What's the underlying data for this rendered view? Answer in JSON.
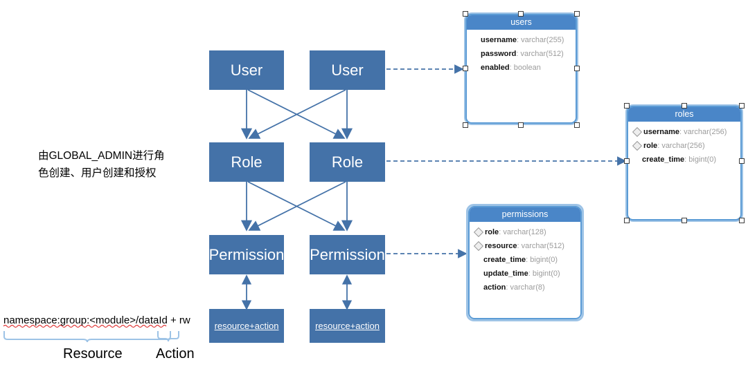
{
  "diagram": {
    "title": "RBAC permission model diagram",
    "colors": {
      "box_fill": "#4472A8",
      "table_header": "#4A86C8",
      "table_border": "#5B9BD5",
      "connector": "#4472A8",
      "arrow": "#4472A8",
      "selection_handle_border": "#3C3C3C",
      "spellcheck_underline": "#E03A3A",
      "brace": "#9DC3E6"
    },
    "flow_boxes": [
      {
        "id": "user-left",
        "label": "User"
      },
      {
        "id": "user-right",
        "label": "User"
      },
      {
        "id": "role-left",
        "label": "Role"
      },
      {
        "id": "role-right",
        "label": "Role"
      },
      {
        "id": "permission-left",
        "label": "Permission"
      },
      {
        "id": "permission-right",
        "label": "Permission"
      },
      {
        "id": "resaction-left",
        "label": "resource+action"
      },
      {
        "id": "resaction-right",
        "label": "resource+action"
      }
    ],
    "annotation": {
      "chinese_note": "由GLOBAL_ADMIN进行角\n色创建、用户创建和授权",
      "resource_expression": "namespace:group:<module>/dataId + rw",
      "brace_resource_label": "Resource",
      "brace_action_label": "Action"
    },
    "tables": [
      {
        "id": "users",
        "name": "users",
        "selected": true,
        "fields": [
          {
            "key": false,
            "name": "username",
            "type": "varchar(255)"
          },
          {
            "key": false,
            "name": "password",
            "type": "varchar(512)"
          },
          {
            "key": false,
            "name": "enabled",
            "type": "boolean"
          }
        ]
      },
      {
        "id": "roles",
        "name": "roles",
        "selected": true,
        "fields": [
          {
            "key": true,
            "name": "username",
            "type": "varchar(256)"
          },
          {
            "key": true,
            "name": "role",
            "type": "varchar(256)"
          },
          {
            "key": false,
            "name": "create_time",
            "type": "bigint(0)"
          }
        ]
      },
      {
        "id": "permissions",
        "name": "permissions",
        "selected": false,
        "fields": [
          {
            "key": true,
            "name": "role",
            "type": "varchar(128)"
          },
          {
            "key": true,
            "name": "resource",
            "type": "varchar(512)"
          },
          {
            "key": false,
            "name": "create_time",
            "type": "bigint(0)"
          },
          {
            "key": false,
            "name": "update_time",
            "type": "bigint(0)"
          },
          {
            "key": false,
            "name": "action",
            "type": "varchar(8)"
          }
        ]
      }
    ],
    "connectors": [
      {
        "from": "user-right",
        "to": "users",
        "style": "dashed"
      },
      {
        "from": "role-right",
        "to": "roles",
        "style": "dashed"
      },
      {
        "from": "permission-right",
        "to": "permissions",
        "style": "dashed"
      }
    ],
    "icons": {
      "key_field": "diamond-key-icon",
      "arrow_head": "arrow-head-icon",
      "handle": "resize-handle-icon"
    }
  }
}
